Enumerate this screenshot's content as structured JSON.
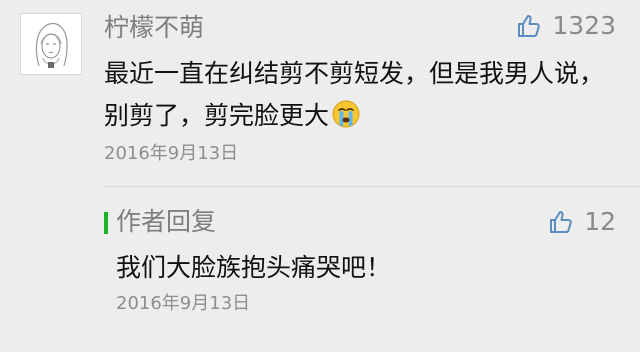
{
  "comment": {
    "username": "柠檬不萌",
    "like_count": "1323",
    "text": "最近一直在纠结剪不剪短发，但是我男人说，别剪了，剪完脸更大",
    "emoji_icon": "crying-face-emoji",
    "date": "2016年9月13日"
  },
  "reply": {
    "label": "作者回复",
    "like_count": "12",
    "text": "我们大脸族抱头痛哭吧！",
    "date": "2016年9月13日",
    "accent_color": "#19b324"
  }
}
